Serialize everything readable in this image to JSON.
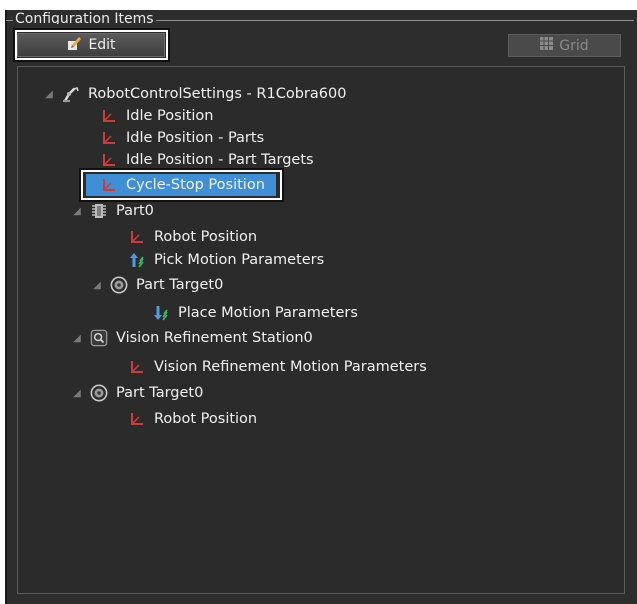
{
  "group": {
    "title": "Configuration Items"
  },
  "toolbar": {
    "edit_label": "Edit",
    "grid_label": "Grid"
  },
  "tree": {
    "root": "RobotControlSettings - R1Cobra600",
    "idle_position": "Idle Position",
    "idle_position_parts": "Idle Position - Parts",
    "idle_position_part_targets": "Idle Position - Part Targets",
    "cycle_stop_position": "Cycle-Stop Position",
    "part0": "Part0",
    "part0_robot_position": "Robot Position",
    "pick_motion_parameters": "Pick Motion Parameters",
    "part_target0_nested": "Part Target0",
    "place_motion_parameters": "Place Motion Parameters",
    "vision_refinement_station0": "Vision Refinement Station0",
    "vision_refinement_motion_parameters": "Vision Refinement Motion Parameters",
    "part_target0": "Part Target0",
    "part_target0_robot_position": "Robot Position"
  },
  "colors": {
    "selection": "#3f8fd6",
    "panel": "#2d2d2d",
    "position_icon": "#d23a3a"
  }
}
